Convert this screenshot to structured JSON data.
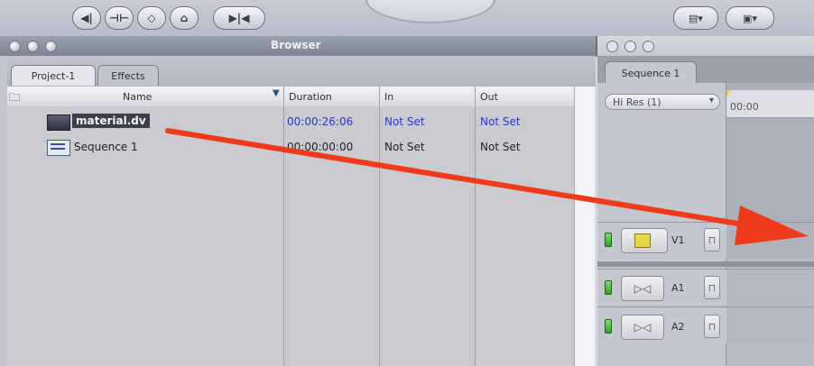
{
  "browser": {
    "title": "Browser",
    "tabs": [
      "Project-1",
      "Effects"
    ],
    "columns": [
      "Name",
      "Duration",
      "In",
      "Out"
    ],
    "items": [
      {
        "name": "material.dv",
        "duration": "00:00:26:06",
        "in": "Not Set",
        "out": "Not Set",
        "selected": true
      },
      {
        "name": "Sequence 1",
        "duration": "00:00:00:00",
        "in": "Not Set",
        "out": "Not Set",
        "selected": false
      }
    ]
  },
  "timeline": {
    "tab": "Sequence 1",
    "resolution": "Hi Res (1)",
    "ruler_timecode": "00:00",
    "tracks": [
      {
        "label": "V1",
        "type": "video"
      },
      {
        "label": "A1",
        "type": "audio"
      },
      {
        "label": "A2",
        "type": "audio"
      }
    ]
  },
  "colors": {
    "accent_blue": "#2a36d8",
    "arrow_red": "#f03a1c",
    "track_green": "#3fbf2c"
  }
}
